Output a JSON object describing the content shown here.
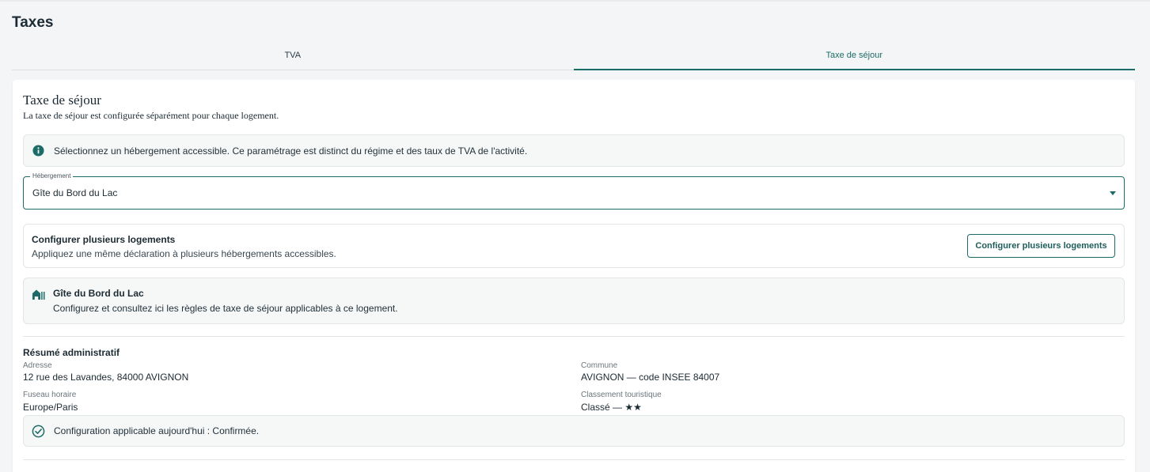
{
  "page": {
    "title": "Taxes"
  },
  "tabs": [
    {
      "label": "TVA",
      "active": false
    },
    {
      "label": "Taxe de séjour",
      "active": true
    }
  ],
  "section": {
    "title": "Taxe de séjour",
    "subtitle": "La taxe de séjour est configurée séparément pour chaque logement."
  },
  "info_notice": {
    "icon": "info-icon",
    "text": "Sélectionnez un hébergement accessible. Ce paramétrage est distinct du régime et des taux de TVA de l'activité."
  },
  "lodging_select": {
    "label": "Hébergement",
    "value": "Gîte du Bord du Lac"
  },
  "multi_config": {
    "title": "Configurer plusieurs logements",
    "description": "Appliquez une même déclaration à plusieurs hébergements accessibles.",
    "button_label": "Configurer plusieurs logements"
  },
  "lodging_card": {
    "icon": "house-icon",
    "title": "Gîte du Bord du Lac",
    "description": "Configurez et consultez ici les règles de taxe de séjour applicables à ce logement."
  },
  "summary": {
    "title": "Résumé administratif",
    "fields": {
      "address": {
        "label": "Adresse",
        "value": "12 rue des Lavandes, 84000 AVIGNON"
      },
      "commune": {
        "label": "Commune",
        "value": "AVIGNON — code INSEE 84007"
      },
      "timezone": {
        "label": "Fuseau horaire",
        "value": "Europe/Paris"
      },
      "classification": {
        "label": "Classement touristique",
        "value": "Classé — ★★"
      }
    }
  },
  "status_notice": {
    "icon": "check-circle-icon",
    "text": "Configuration applicable aujourd'hui : Confirmée."
  },
  "colors": {
    "accent": "#1d6b67",
    "background": "#f4f5f6",
    "panel": "#ffffff",
    "notice_bg": "#f6f8f8"
  }
}
